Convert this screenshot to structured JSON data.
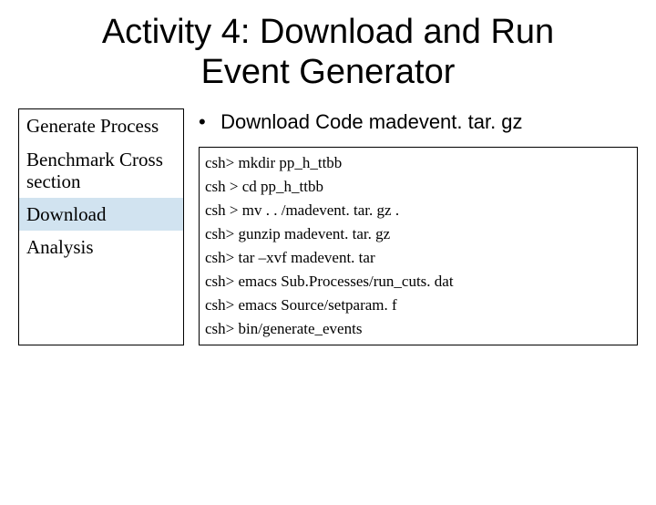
{
  "title": "Activity 4: Download and Run Event Generator",
  "steps": {
    "generate": "Generate Process",
    "benchmark": "Benchmark Cross section",
    "download": "Download",
    "analysis": "Analysis"
  },
  "bullet": {
    "dot": "•",
    "text": "Download Code  madevent. tar. gz"
  },
  "terminal": {
    "l0": "csh> mkdir pp_h_ttbb",
    "l1": "csh > cd pp_h_ttbb",
    "l2": "csh > mv . . /madevent. tar. gz .",
    "l3": "csh> gunzip madevent. tar. gz",
    "l4": "csh> tar –xvf madevent. tar",
    "l5": "csh> emacs Sub.Processes/run_cuts. dat",
    "l6": "csh> emacs Source/setparam. f",
    "l7": "csh> bin/generate_events"
  }
}
